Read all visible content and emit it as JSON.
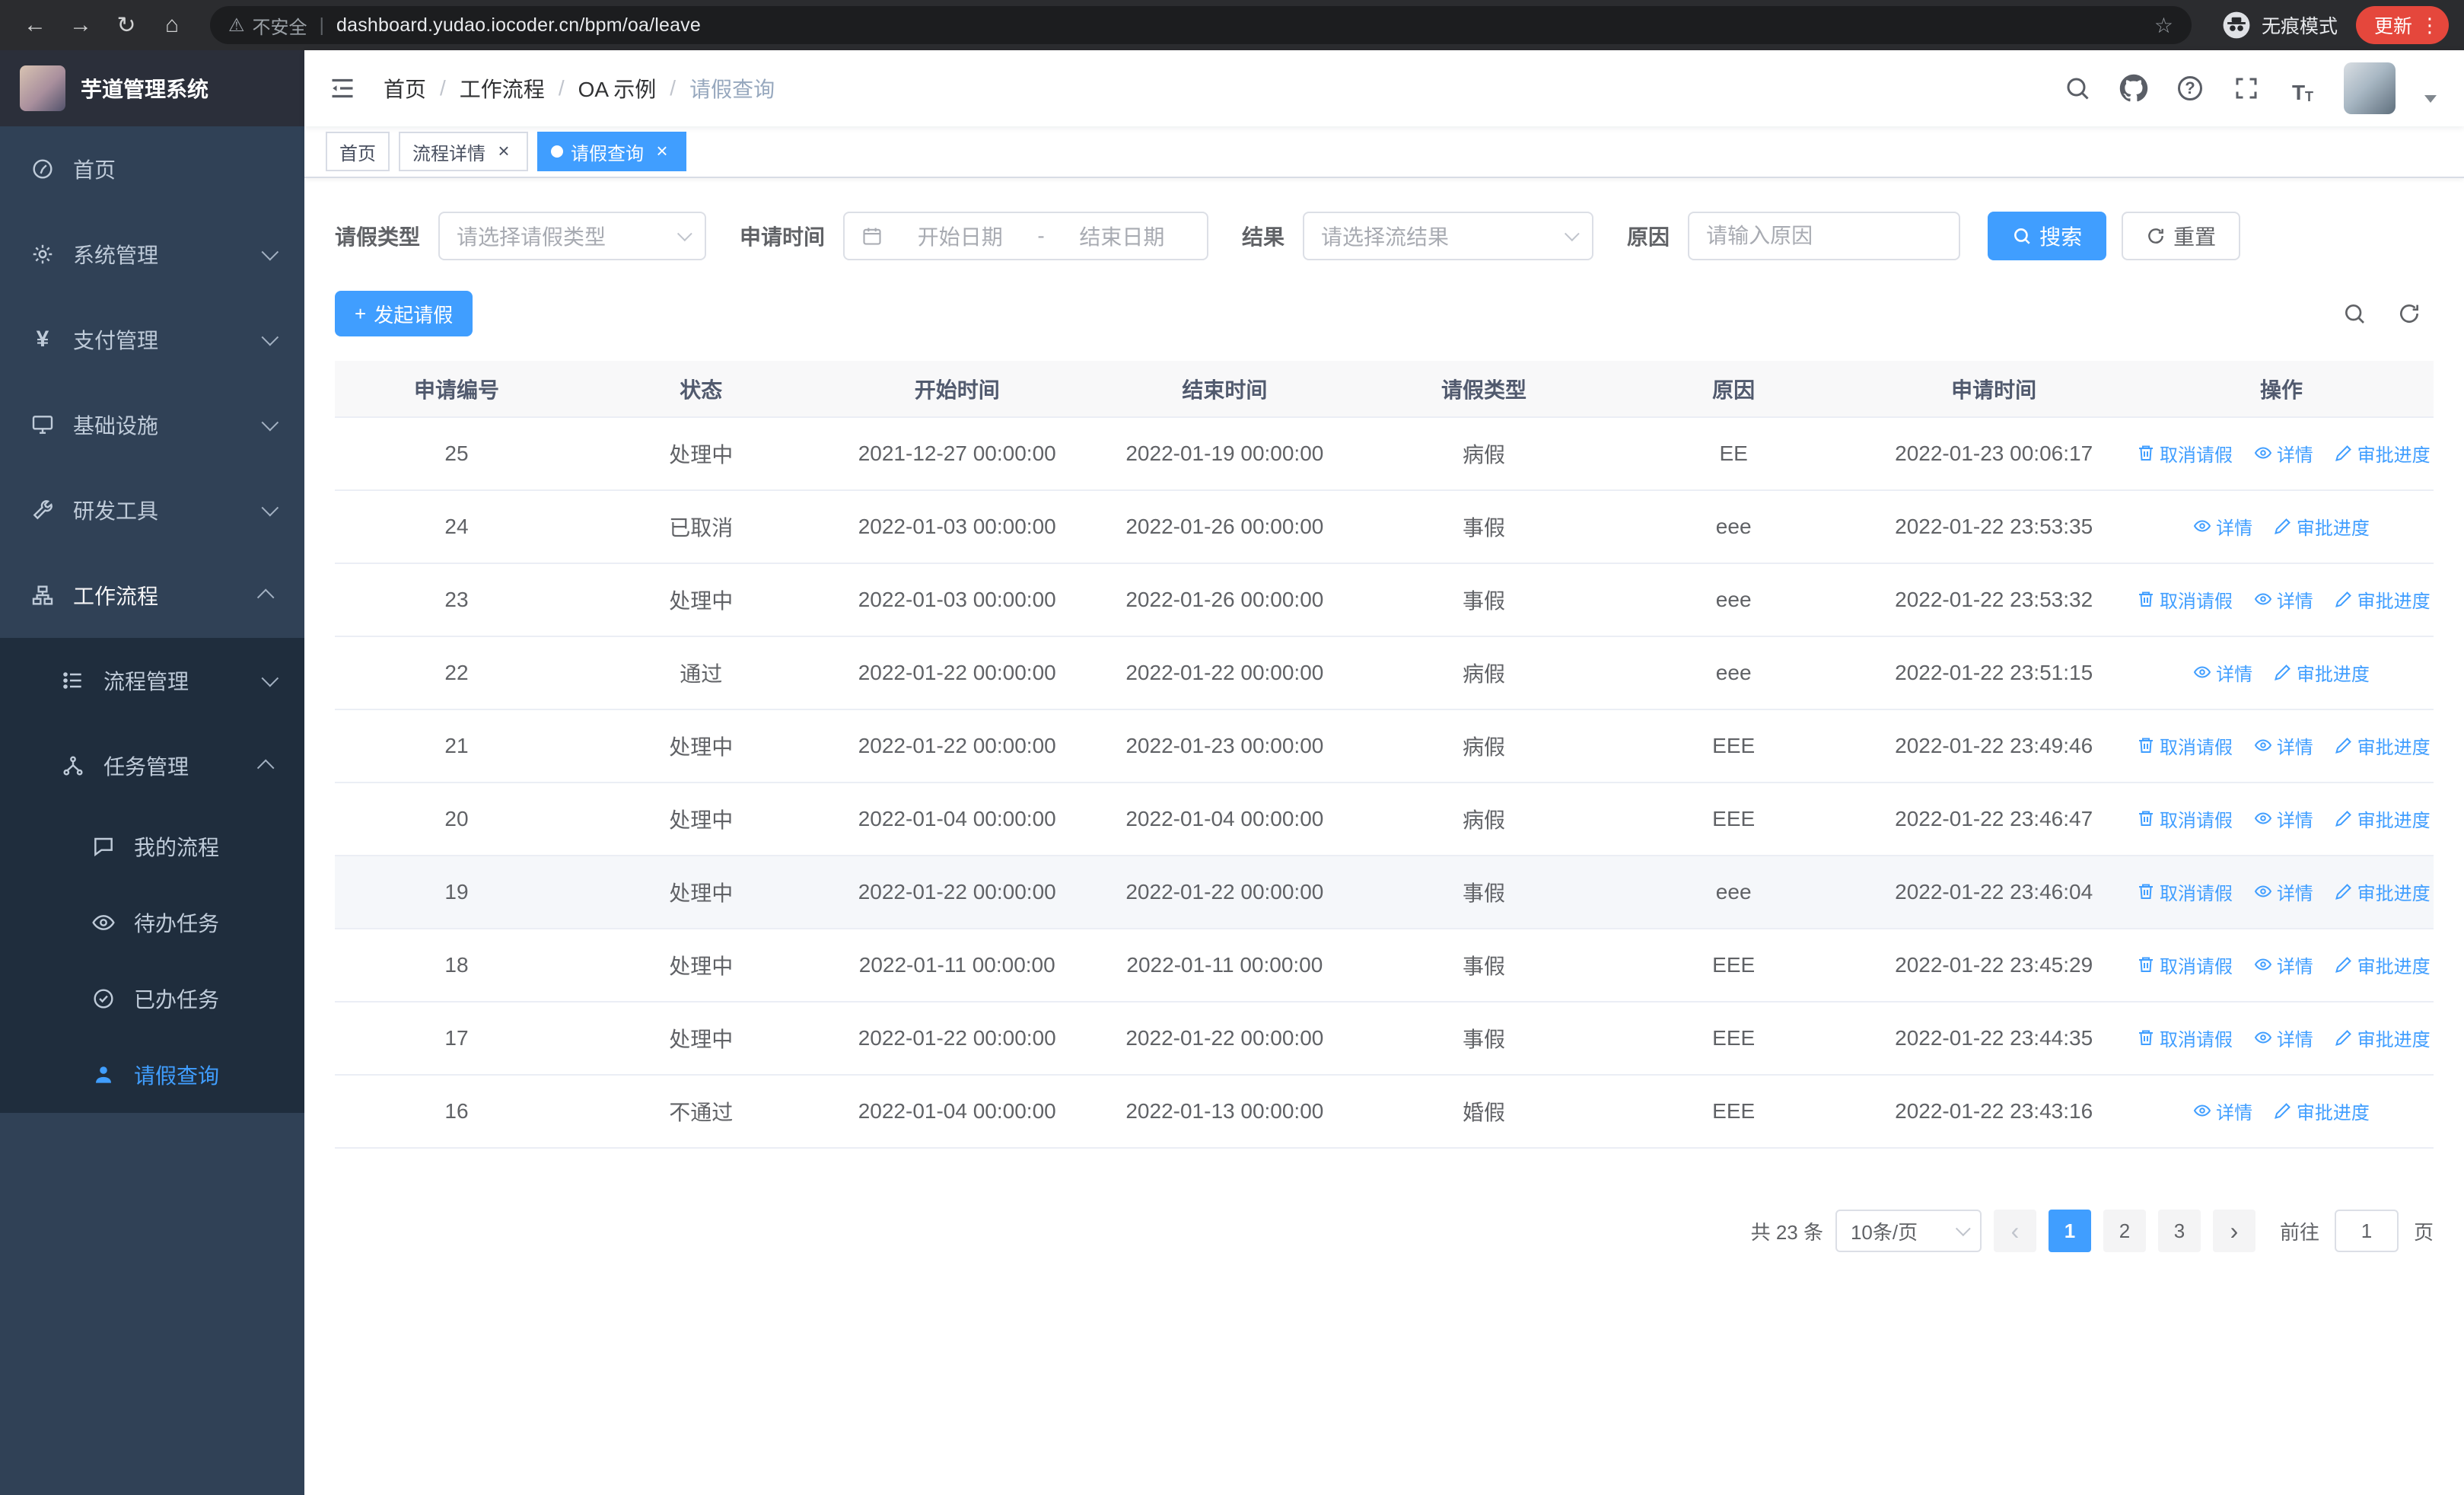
{
  "browser": {
    "security_label": "不安全",
    "url": "dashboard.yudao.iocoder.cn/bpm/oa/leave",
    "incognito_label": "无痕模式",
    "update_label": "更新"
  },
  "icons": {
    "back": "←",
    "forward": "→",
    "reload": "↻",
    "home": "⌂",
    "warning": "⚠",
    "star": "☆",
    "dots": "⋮",
    "plus": "+",
    "close": "×",
    "prev": "‹",
    "next": "›",
    "question": "?",
    "slash": "/",
    "yen": "¥",
    "font_large": "T",
    "font_small": "T"
  },
  "sidebar": {
    "logo_title": "芋道管理系统",
    "menu": [
      {
        "label": "首页"
      },
      {
        "label": "系统管理"
      },
      {
        "label": "支付管理"
      },
      {
        "label": "基础设施"
      },
      {
        "label": "研发工具"
      },
      {
        "label": "工作流程"
      },
      {
        "label": "流程管理"
      },
      {
        "label": "任务管理"
      },
      {
        "label": "我的流程"
      },
      {
        "label": "待办任务"
      },
      {
        "label": "已办任务"
      },
      {
        "label": "请假查询"
      }
    ]
  },
  "header": {
    "breadcrumb": [
      "首页",
      "工作流程",
      "OA 示例",
      "请假查询"
    ]
  },
  "tags": [
    {
      "label": "首页"
    },
    {
      "label": "流程详情"
    },
    {
      "label": "请假查询"
    }
  ],
  "filters": {
    "leave_type_label": "请假类型",
    "leave_type_placeholder": "请选择请假类型",
    "apply_time_label": "申请时间",
    "start_date_placeholder": "开始日期",
    "range_separator": "-",
    "end_date_placeholder": "结束日期",
    "result_label": "结果",
    "result_placeholder": "请选择流结果",
    "reason_label": "原因",
    "reason_placeholder": "请输入原因",
    "search_label": "搜索",
    "reset_label": "重置"
  },
  "toolbar": {
    "create_label": "发起请假"
  },
  "table": {
    "columns": [
      "申请编号",
      "状态",
      "开始时间",
      "结束时间",
      "请假类型",
      "原因",
      "申请时间",
      "操作"
    ],
    "action_labels": {
      "cancel": "取消请假",
      "detail": "详情",
      "progress": "审批进度"
    },
    "rows": [
      {
        "id": "25",
        "status": "处理中",
        "start": "2021-12-27 00:00:00",
        "end": "2022-01-19 00:00:00",
        "type": "病假",
        "reason": "EE",
        "applied": "2022-01-23 00:06:17"
      },
      {
        "id": "24",
        "status": "已取消",
        "start": "2022-01-03 00:00:00",
        "end": "2022-01-26 00:00:00",
        "type": "事假",
        "reason": "eee",
        "applied": "2022-01-22 23:53:35"
      },
      {
        "id": "23",
        "status": "处理中",
        "start": "2022-01-03 00:00:00",
        "end": "2022-01-26 00:00:00",
        "type": "事假",
        "reason": "eee",
        "applied": "2022-01-22 23:53:32"
      },
      {
        "id": "22",
        "status": "通过",
        "start": "2022-01-22 00:00:00",
        "end": "2022-01-22 00:00:00",
        "type": "病假",
        "reason": "eee",
        "applied": "2022-01-22 23:51:15"
      },
      {
        "id": "21",
        "status": "处理中",
        "start": "2022-01-22 00:00:00",
        "end": "2022-01-23 00:00:00",
        "type": "病假",
        "reason": "EEE",
        "applied": "2022-01-22 23:49:46"
      },
      {
        "id": "20",
        "status": "处理中",
        "start": "2022-01-04 00:00:00",
        "end": "2022-01-04 00:00:00",
        "type": "病假",
        "reason": "EEE",
        "applied": "2022-01-22 23:46:47"
      },
      {
        "id": "19",
        "status": "处理中",
        "start": "2022-01-22 00:00:00",
        "end": "2022-01-22 00:00:00",
        "type": "事假",
        "reason": "eee",
        "applied": "2022-01-22 23:46:04"
      },
      {
        "id": "18",
        "status": "处理中",
        "start": "2022-01-11 00:00:00",
        "end": "2022-01-11 00:00:00",
        "type": "事假",
        "reason": "EEE",
        "applied": "2022-01-22 23:45:29"
      },
      {
        "id": "17",
        "status": "处理中",
        "start": "2022-01-22 00:00:00",
        "end": "2022-01-22 00:00:00",
        "type": "事假",
        "reason": "EEE",
        "applied": "2022-01-22 23:44:35"
      },
      {
        "id": "16",
        "status": "不通过",
        "start": "2022-01-04 00:00:00",
        "end": "2022-01-13 00:00:00",
        "type": "婚假",
        "reason": "EEE",
        "applied": "2022-01-22 23:43:16"
      }
    ]
  },
  "pagination": {
    "total_label": "共 23 条",
    "page_size": "10条/页",
    "pages": [
      "1",
      "2",
      "3"
    ],
    "goto_label": "前往",
    "goto_value": "1",
    "page_unit": "页"
  },
  "colors": {
    "primary": "#409eff",
    "sidebar_bg": "#304156",
    "submenu_bg": "#1f2d3d",
    "update_pill": "#e5473c"
  }
}
